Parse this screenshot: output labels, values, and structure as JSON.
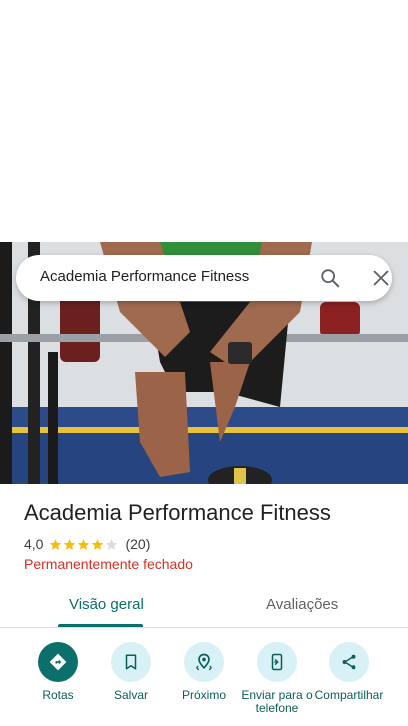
{
  "search": {
    "query": "Academia Performance Fitness"
  },
  "place": {
    "name": "Academia Performance Fitness",
    "rating": "4,0",
    "stars_filled": 4,
    "stars_total": 5,
    "review_count": "(20)",
    "status": "Permanentemente fechado"
  },
  "tabs": [
    {
      "label": "Visão geral",
      "selected": true
    },
    {
      "label": "Avaliações",
      "selected": false
    }
  ],
  "actions": [
    {
      "label": "Rotas",
      "icon": "directions-icon"
    },
    {
      "label": "Salvar",
      "icon": "bookmark-icon"
    },
    {
      "label": "Próximo",
      "icon": "nearby-icon"
    },
    {
      "label": "Enviar para o telefone",
      "icon": "send-to-phone-icon"
    },
    {
      "label": "Compartilhar",
      "icon": "share-icon"
    }
  ],
  "colors": {
    "accent": "#0b6f6b",
    "closed_status": "#d93025",
    "star": "#fbbc04",
    "action_bg": "#d8f1f7"
  }
}
